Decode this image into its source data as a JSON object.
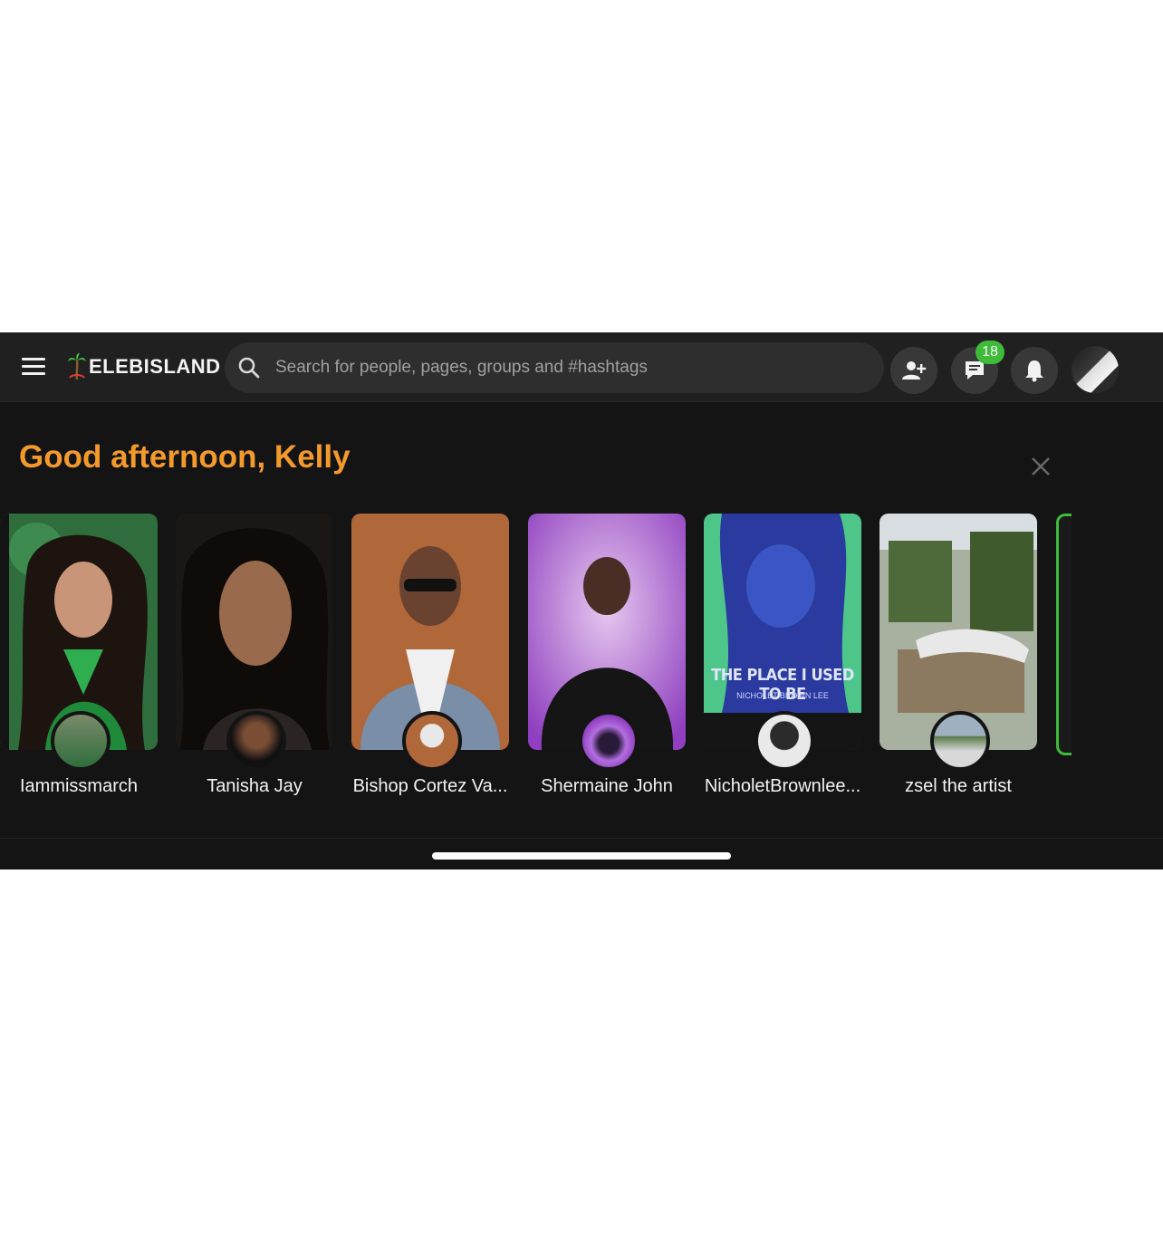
{
  "header": {
    "logo_text": "ELEBISLAND",
    "search_placeholder": "Search for people, pages, groups and #hashtags",
    "messages_badge": "18",
    "colors": {
      "background": "#202020",
      "accent_green": "#3dbb39"
    },
    "icons": [
      "menu-icon",
      "search-icon",
      "add-friend-icon",
      "chat-icon",
      "bell-icon"
    ]
  },
  "greeting": {
    "text": "Good afternoon, Kelly",
    "color": "#f39a2b"
  },
  "stories": [
    {
      "name": "Iammissmarch"
    },
    {
      "name": "Tanisha Jay"
    },
    {
      "name": "Bishop Cortez Va..."
    },
    {
      "name": "Shermaine John"
    },
    {
      "name": "NicholetBrownlee...",
      "art_title": "THE PLACE I USED TO BE",
      "art_subtitle": "NICHOLET BROWN LEE"
    },
    {
      "name": "zsel the artist"
    }
  ]
}
